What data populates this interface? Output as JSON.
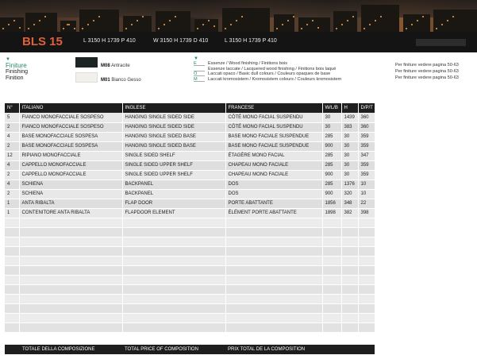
{
  "header": {
    "model": "BLS 15",
    "dimensions": [
      "L 3150 H 1739 P 410",
      "W 3150 H 1739 D 410",
      "L 3150 H 1739 P 410"
    ]
  },
  "finishes": {
    "title_it": "Finiture",
    "title_en": "Finishing",
    "title_fr": "Finition",
    "swatches": [
      {
        "code": "M08",
        "name": "Antracite",
        "color": "#1c2424"
      },
      {
        "code": "M01",
        "name": "Bianco Gesso",
        "color": "#f2f0ea"
      }
    ]
  },
  "legend": {
    "items": [
      {
        "key": "E",
        "text": "Essenze / Wood finishing / Finitions bois"
      },
      {
        "key": "",
        "text": "Essenze laccate / Lacquered wood finishing / Finitions bois laqué"
      },
      {
        "key": "O",
        "text": "Laccati opaco / Basic dull colours / Couleurs opaques de base"
      },
      {
        "key": "M",
        "text": "Laccati kromosistem / Kromosistem colours / Couleurs kromosistem"
      }
    ],
    "notes": [
      "Per finiture vedere pagina 50-63",
      "Per finiture vedere pagina 50-63",
      "Per finiture vedere pagina 50-63"
    ]
  },
  "table": {
    "columns": [
      "N°",
      "ITALIANO",
      "INGLESE",
      "FRANCESE",
      "W/L/B",
      "H",
      "D/P/T"
    ],
    "rows": [
      [
        "5",
        "FIANCO MONOFACCIALE SOSPESO",
        "HANGING SINGLE SIDED SIDE",
        "CÔTÉ MONO FACIAL SUSPENDU",
        "30",
        "1439",
        "360"
      ],
      [
        "2",
        "FIANCO MONOFACCIALE SOSPESO",
        "HANGING SINGLE SIDED SIDE",
        "CÔTÉ MONO FACIAL SUSPENDU",
        "30",
        "383",
        "360"
      ],
      [
        "4",
        "BASE MONOFACCIALE SOSPESA",
        "HANGING SINGLE SIDED BASE",
        "BASE MONO FACIALE SUSPENDUE",
        "285",
        "30",
        "359"
      ],
      [
        "2",
        "BASE MONOFACCIALE SOSPESA",
        "HANGING SINGLE SIDED BASE",
        "BASE MONO FACIALE SUSPENDUE",
        "900",
        "30",
        "359"
      ],
      [
        "12",
        "RIPIANO MONOFACCIALE",
        "SINGLE SIDED SHELF",
        "ÉTAGÈRE MONO FACIAL",
        "285",
        "30",
        "347"
      ],
      [
        "4",
        "CAPPELLO MONOFACCIALE",
        "SINGLE SIDED UPPER SHELF",
        "CHAPEAU MONO FACIALE",
        "285",
        "30",
        "359"
      ],
      [
        "2",
        "CAPPELLO MONOFACCIALE",
        "SINGLE SIDED UPPER SHELF",
        "CHAPEAU MONO FACIALE",
        "900",
        "30",
        "359"
      ],
      [
        "4",
        "SCHIENA",
        "BACKPANEL",
        "DOS",
        "285",
        "1376",
        "10"
      ],
      [
        "2",
        "SCHIENA",
        "BACKPANEL",
        "DOS",
        "900",
        "320",
        "10"
      ],
      [
        "1",
        "ANTA RIBALTA",
        "FLAP DOOR",
        "PORTE ABATTANTE",
        "1856",
        "348",
        "22"
      ],
      [
        "1",
        "CONTENITORE ANTA RIBALTA",
        "FLAPDOOR ELEMENT",
        "ÉLÉMENT PORTE ABATTANTE",
        "1898",
        "382",
        "398"
      ]
    ],
    "empty_rows": 12
  },
  "totals": {
    "it": "TOTALE DELLA COMPOSIZIONE",
    "en": "TOTAL PRICE OF COMPOSITION",
    "fr": "PRIX TOTAL DE LA COMPOSITION"
  }
}
